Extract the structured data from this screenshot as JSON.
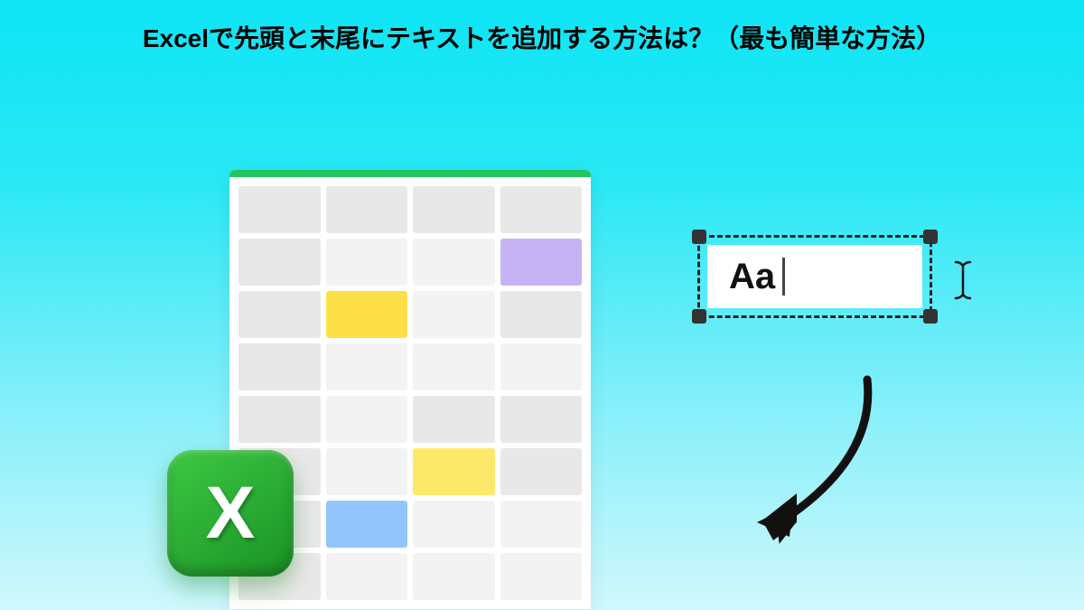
{
  "title": "Excelで先頭と末尾にテキストを追加する方法は？（最も簡単な方法）",
  "textbox": {
    "value": "Aa"
  },
  "excel_icon": {
    "letter": "X"
  },
  "ibeam_glyph": "Ⅰ",
  "colors": {
    "excel_green": "#22c55e",
    "cell_purple": "#c5b3f5",
    "cell_yellow": "#fde047",
    "cell_blue": "#93c5fd"
  },
  "spreadsheet": {
    "rows": 8,
    "cols": 4,
    "highlighted_cells": [
      {
        "row": 2,
        "col": 4,
        "color": "purple"
      },
      {
        "row": 3,
        "col": 2,
        "color": "yellow"
      },
      {
        "row": 6,
        "col": 3,
        "color": "yellow"
      },
      {
        "row": 7,
        "col": 2,
        "color": "blue"
      }
    ]
  }
}
